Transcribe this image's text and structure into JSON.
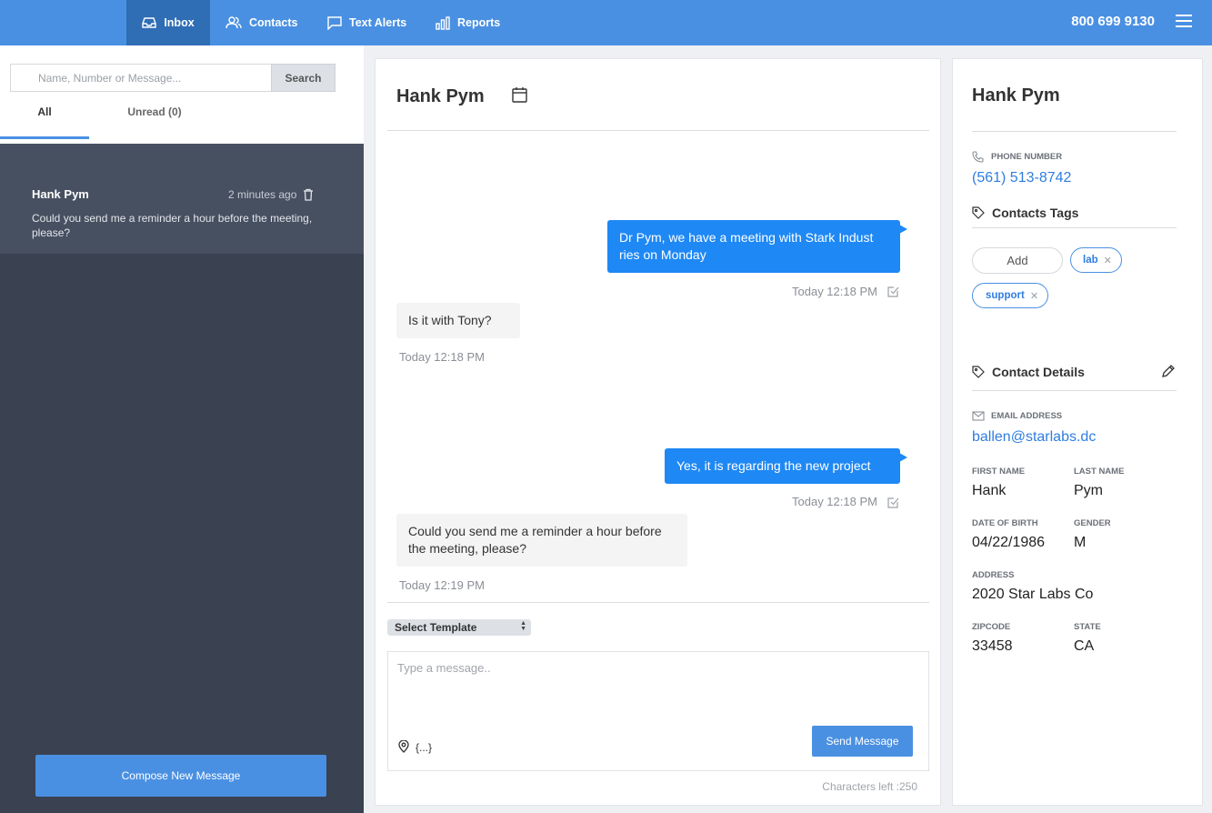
{
  "header": {
    "nav": [
      {
        "label": "Inbox",
        "icon": "inbox-icon"
      },
      {
        "label": "Contacts",
        "icon": "contacts-icon"
      },
      {
        "label": "Text Alerts",
        "icon": "chat-icon"
      },
      {
        "label": "Reports",
        "icon": "bar-chart-icon"
      }
    ],
    "phone": "800 699 9130",
    "accent": "#4a90e2"
  },
  "sidebar": {
    "search": {
      "placeholder": "Name, Number or Message...",
      "button": "Search"
    },
    "tabs": {
      "all": "All",
      "unread": "Unread (0)"
    },
    "conversations": [
      {
        "name": "Hank Pym",
        "time": "2 minutes ago",
        "preview": "Could you send me a reminder a hour before the meeting, please?"
      }
    ],
    "compose": "Compose New Message"
  },
  "chat": {
    "title": "Hank Pym",
    "messages": [
      {
        "direction": "out",
        "text": "Dr Pym, we have a meeting with Stark Indust ries on Monday",
        "time": "Today 12:18 PM"
      },
      {
        "direction": "in",
        "text": "Is it with Tony?",
        "time": "Today 12:18 PM"
      },
      {
        "direction": "out",
        "text": "Yes, it is regarding the new project",
        "time": "Today 12:18 PM"
      },
      {
        "direction": "in",
        "text": "Could you send me a reminder a hour before the meeting, please?",
        "time": "Today 12:19 PM"
      }
    ],
    "template": "Select Template",
    "input_placeholder": "Type a message..",
    "braces": "{...}",
    "send": "Send Message",
    "chars_left": "Characters left :250"
  },
  "contact": {
    "name": "Hank Pym",
    "phone_label": "PHONE NUMBER",
    "phone": "(561) 513-8742",
    "tags_title": "Contacts Tags",
    "tag_add": "Add",
    "tags": [
      "lab",
      "support"
    ],
    "details_title": "Contact Details",
    "email_label": "EMAIL ADDRESS",
    "email": "ballen@starlabs.dc",
    "first_name_label": "FIRST NAME",
    "first_name": "Hank",
    "last_name_label": "LAST NAME",
    "last_name": "Pym",
    "dob_label": "DATE OF BIRTH",
    "dob": "04/22/1986",
    "gender_label": "GENDER",
    "gender": "M",
    "address_label": "ADDRESS",
    "address": "2020 Star Labs Co",
    "zip_label": "ZIPCODE",
    "zip": "33458",
    "state_label": "STATE",
    "state": "CA"
  }
}
